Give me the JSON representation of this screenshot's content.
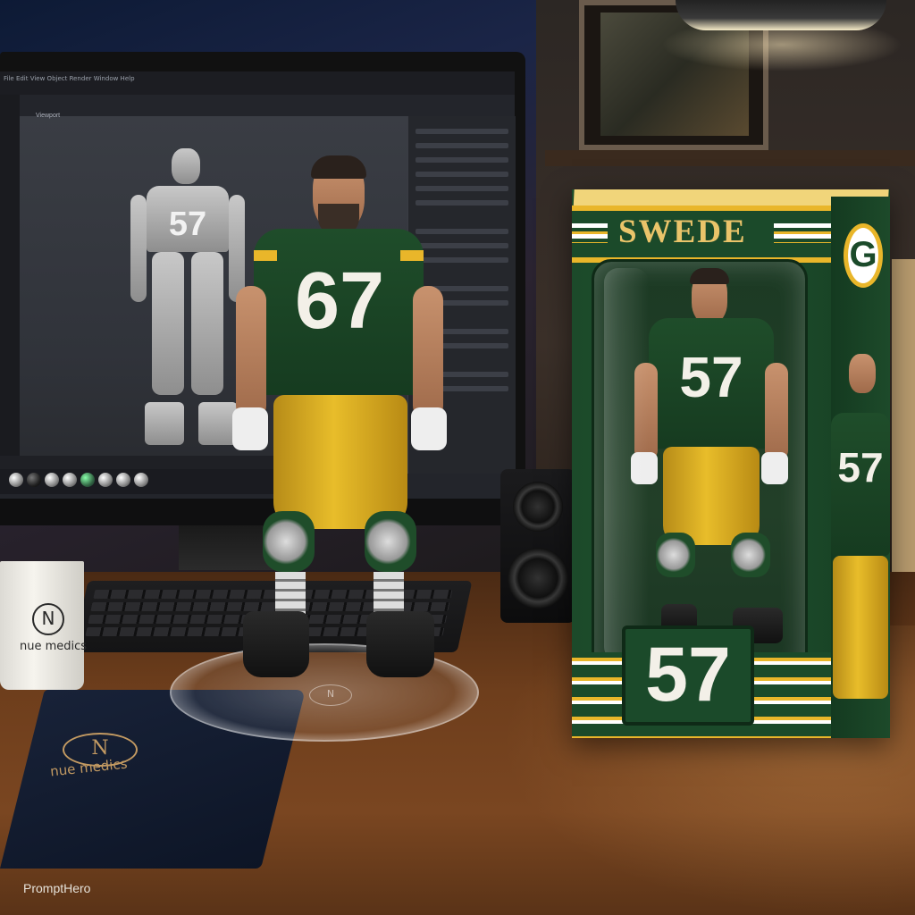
{
  "watermark": "PromptHero",
  "mug": {
    "logo_glyph": "N",
    "brand_text": "nue medics"
  },
  "notebook": {
    "logo_glyph": "N",
    "brand_text": "nue medics"
  },
  "figure": {
    "jersey_number": "67"
  },
  "screen_model": {
    "jersey_number": "57"
  },
  "box": {
    "name": "SWEDE",
    "logo_letter": "G",
    "number": "57",
    "inner_figure_number": "57",
    "side_figure_number": "57"
  },
  "monitor": {
    "menu_text": "File  Edit  View  Object  Render  Window  Help",
    "viewport_tab": "Viewport"
  },
  "colors": {
    "jersey_green": "#1f4d2a",
    "jersey_gold": "#e9b62a",
    "box_green": "#1c4a2a"
  }
}
